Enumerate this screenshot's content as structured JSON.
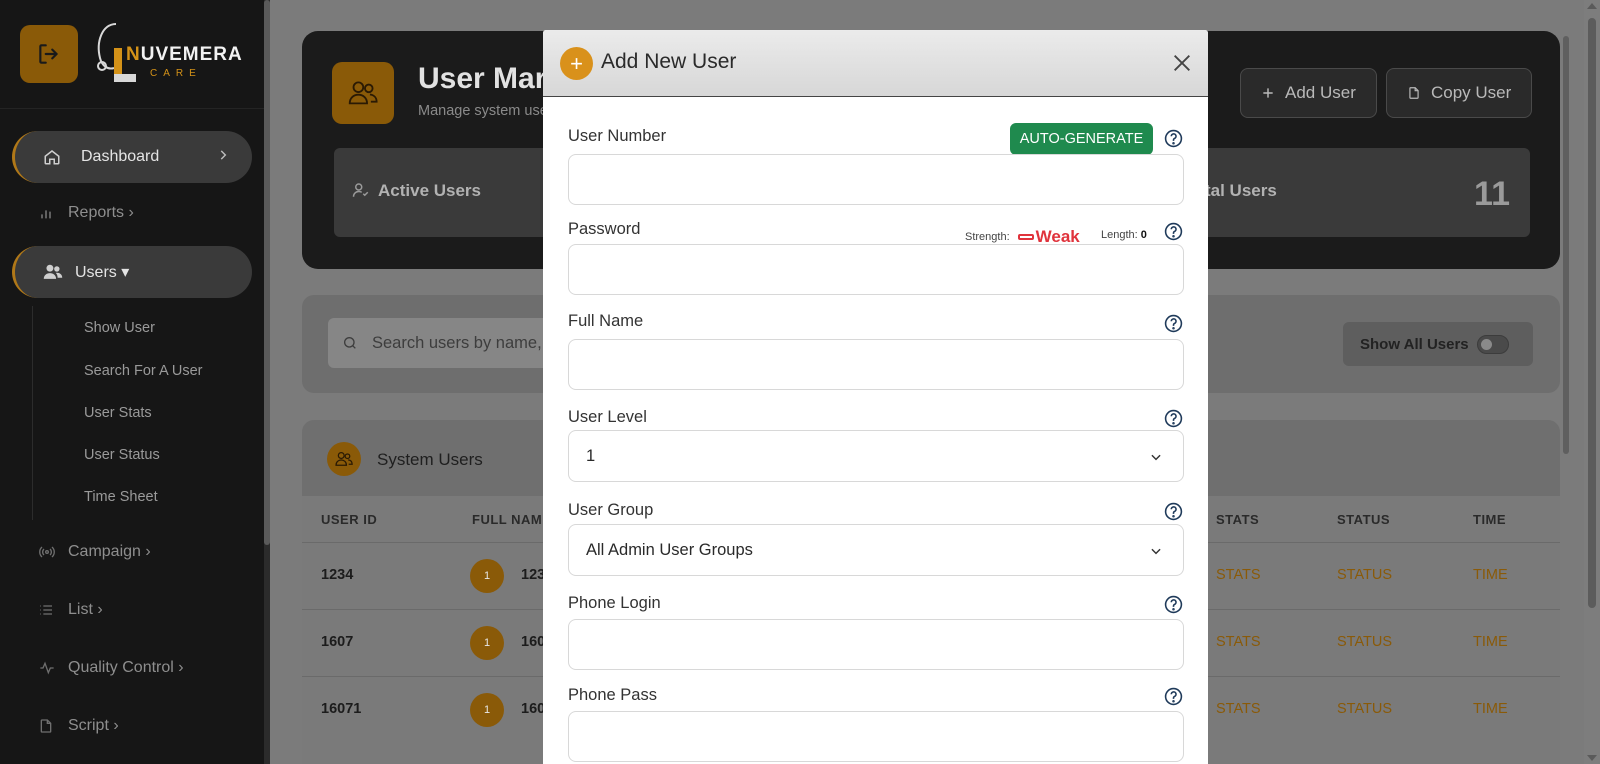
{
  "brand": {
    "name_first_letter": "N",
    "name_rest": "UVEMERA",
    "tagline": "CARE"
  },
  "sidebar": {
    "dashboard": "Dashboard",
    "reports": "Reports ›",
    "users": "Users ▾",
    "users_sub": [
      "Show User",
      "Search For A User",
      "User Stats",
      "User Status",
      "Time Sheet"
    ],
    "campaign": "Campaign ›",
    "list": "List ›",
    "quality_control": "Quality Control ›",
    "script": "Script ›"
  },
  "header": {
    "title": "User Mar",
    "subtitle": "Manage system use",
    "add_user": "Add User",
    "copy_user": "Copy User"
  },
  "stats": {
    "active_label": "Active Users",
    "total_label": "tal Users",
    "total_value": "11"
  },
  "search": {
    "placeholder": "Search users by name,",
    "show_all": "Show All Users"
  },
  "table": {
    "title": "System Users",
    "headers": [
      "USER ID",
      "FULL NAME",
      "STATS",
      "STATUS",
      "TIME"
    ],
    "rows": [
      {
        "id": "1234",
        "level": "1",
        "name": "123",
        "stats": "STATS",
        "status": "STATUS",
        "time": "TIME"
      },
      {
        "id": "1607",
        "level": "1",
        "name": "160",
        "stats": "STATS",
        "status": "STATUS",
        "time": "TIME"
      },
      {
        "id": "16071",
        "level": "1",
        "name": "160",
        "stats": "STATS",
        "status": "STATUS",
        "time": "TIME"
      }
    ]
  },
  "modal": {
    "title": "Add New User",
    "auto_generate": "AUTO-GENERATE",
    "fields": {
      "user_number": {
        "label": "User Number",
        "value": ""
      },
      "password": {
        "label": "Password",
        "value": ""
      },
      "full_name": {
        "label": "Full Name",
        "value": ""
      },
      "user_level": {
        "label": "User Level",
        "value": "1"
      },
      "user_group": {
        "label": "User Group",
        "value": "All Admin User Groups"
      },
      "phone_login": {
        "label": "Phone Login",
        "value": ""
      },
      "phone_pass": {
        "label": "Phone Pass",
        "value": ""
      }
    },
    "strength_label": "Strength:",
    "strength_value": "Weak",
    "length_label": "Length:",
    "length_value": "0"
  },
  "colors": {
    "accent": "#d9911b",
    "success": "#1f8a4e",
    "danger": "#e0333c",
    "sidebar_bg": "#161616"
  },
  "icons": {
    "logout": "logout-icon",
    "home": "home-icon",
    "chart": "bar-chart-icon",
    "users": "users-icon",
    "broadcast": "broadcast-icon",
    "list": "list-icon",
    "pulse": "pulse-icon",
    "file": "file-icon",
    "search": "search-icon",
    "plus": "plus-icon",
    "close": "close-icon",
    "help": "help-circle-icon"
  }
}
